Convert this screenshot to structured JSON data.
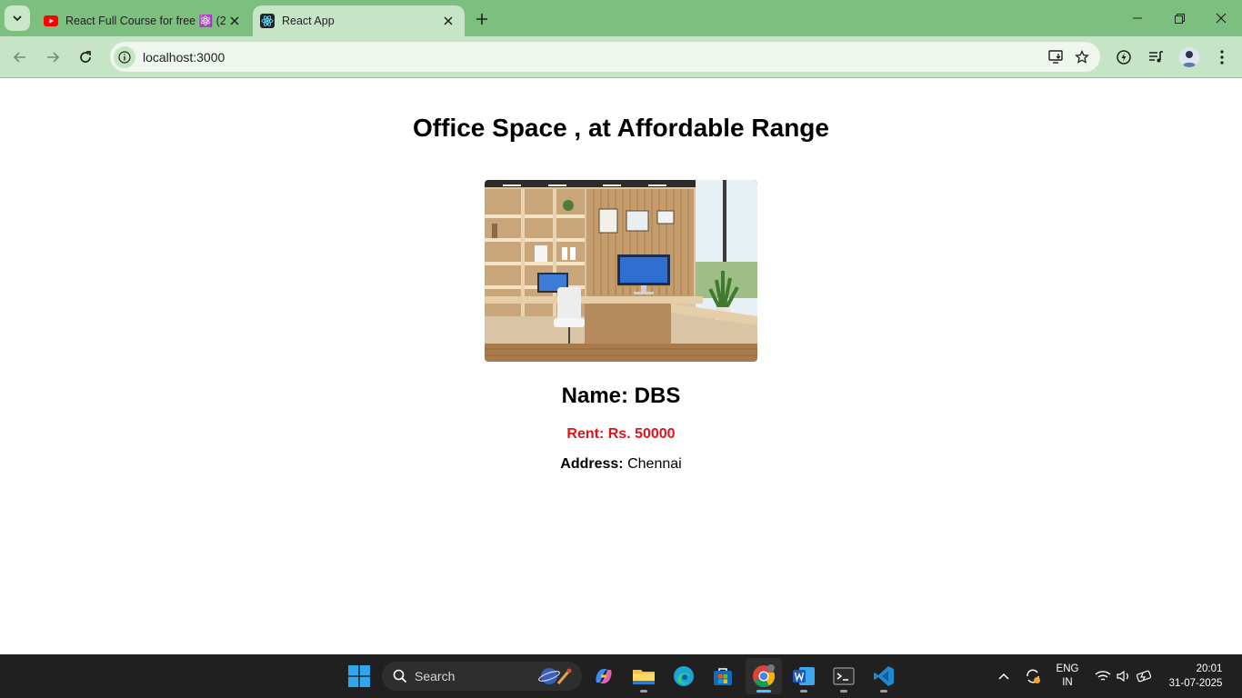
{
  "browser": {
    "tabs": [
      {
        "title": "React Full Course for free ⚛️ (2",
        "favicon": "youtube-icon",
        "active": false
      },
      {
        "title": "React App",
        "favicon": "react-icon",
        "active": true
      }
    ],
    "url": "localhost:3000"
  },
  "page": {
    "heading": "Office Space , at Affordable Range",
    "image_alt": "office-interior-image",
    "name_label": "Name: DBS",
    "rent_label": "Rent: Rs. 50000",
    "address_label": "Address:",
    "address_value": "Chennai"
  },
  "taskbar": {
    "search_label": "Search",
    "language_line1": "ENG",
    "language_line2": "IN",
    "time": "20:01",
    "date": "31-07-2025"
  },
  "colors": {
    "tabstrip": "#7cbf7e",
    "toolbar": "#c6e5c6",
    "rent_text": "#e0151a",
    "taskbar": "#202020"
  }
}
